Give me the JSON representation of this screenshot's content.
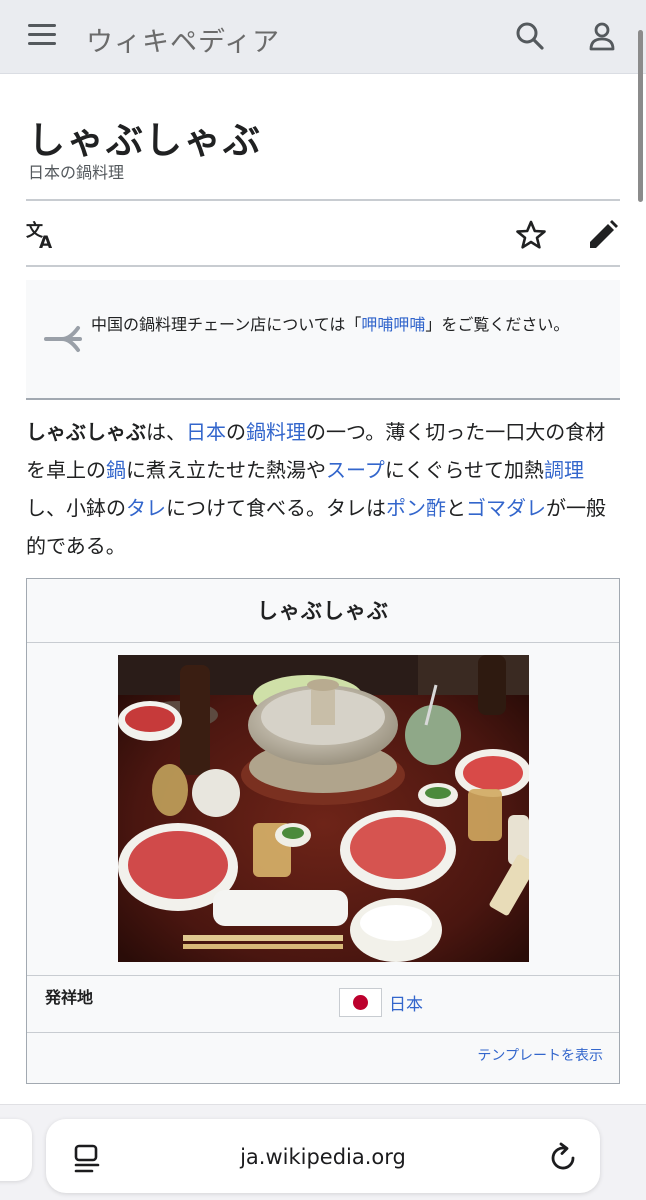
{
  "header": {
    "logo_text": "ウィキペディア",
    "menu_icon": "menu-icon",
    "search_icon": "search-icon",
    "user_icon": "user-icon"
  },
  "article": {
    "title": "しゃぶしゃぶ",
    "subtitle": "日本の鍋料理",
    "actions": {
      "language_icon": "language-icon",
      "watch_icon": "star-icon",
      "edit_icon": "pencil-icon"
    }
  },
  "hatnote": {
    "text_before": "中国の鍋料理チェーン店については「",
    "link_text": "呷哺呷哺",
    "text_after": "」をご覧ください。"
  },
  "lead": {
    "term": "しゃぶしゃぶ",
    "t1": "は、",
    "l1": "日本",
    "t2": "の",
    "l2": "鍋料理",
    "t3": "の一つ。薄く切った一口大の食材を卓上の",
    "l3": "鍋",
    "t4": "に煮え立たせた熱湯や",
    "l4": "スープ",
    "t5": "にくぐらせて加熱",
    "l5": "調理",
    "t6": "し、小鉢の",
    "l6": "タレ",
    "t7": "につけて食べる。タレは",
    "l7": "ポン酢",
    "t8": "と",
    "l8": "ゴマダレ",
    "t9": "が一般的である。"
  },
  "infobox": {
    "title": "しゃぶしゃぶ",
    "origin_label": "発祥地",
    "origin_value": "日本",
    "footer_link": "テンプレートを表示"
  },
  "browser": {
    "url": "ja.wikipedia.org",
    "reader_icon": "reader-mode-icon",
    "reload_icon": "reload-icon"
  },
  "colors": {
    "link": "#3366cc",
    "header_bg": "#eaecf0",
    "text": "#202122",
    "flag_red": "#bc002d"
  }
}
